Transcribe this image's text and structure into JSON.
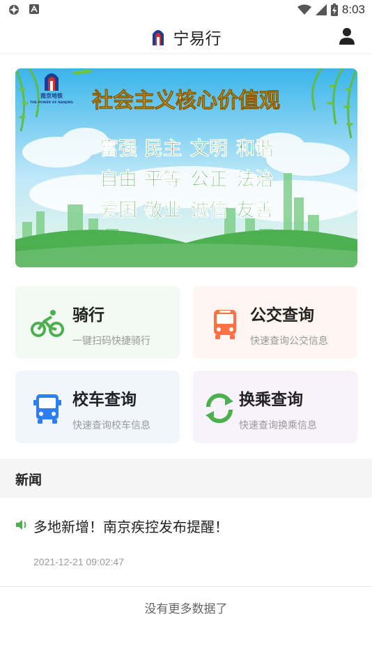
{
  "statusbar": {
    "time": "8:03",
    "icons": [
      "settings-icon",
      "notification-a-icon",
      "wifi-icon",
      "signal-icon",
      "battery-icon"
    ]
  },
  "appbar": {
    "title": "宁易行",
    "logo_icon": "nanjing-metro-logo-icon",
    "user_icon": "user-icon"
  },
  "banner": {
    "headline": "社会主义核心价值观",
    "values": [
      "富强",
      "民主",
      "文明",
      "和谐",
      "自由",
      "平等",
      "公正",
      "法治",
      "爱国",
      "敬业",
      "诚信",
      "友善"
    ],
    "logo_text": "南京地铁",
    "logo_subtext": "THE POWER OF NANJING"
  },
  "cards": [
    {
      "title": "骑行",
      "subtitle": "一键扫码快捷骑行",
      "icon": "bicycle-icon",
      "bg": "#f3f9f3",
      "color": "#4caf50"
    },
    {
      "title": "公交查询",
      "subtitle": "快速查询公交信息",
      "icon": "bus-icon",
      "bg": "#fff6f1",
      "color": "#ff7043"
    },
    {
      "title": "校车查询",
      "subtitle": "快速查询校车信息",
      "icon": "school-bus-icon",
      "bg": "#f1f6fd",
      "color": "#2e7ef0"
    },
    {
      "title": "换乘查询",
      "subtitle": "快速查询换乘信息",
      "icon": "transfer-icon",
      "bg": "#f8f3fa",
      "color": "#4caf50"
    }
  ],
  "news": {
    "section_title": "新闻",
    "items": [
      {
        "title": "多地新增！南京疾控发布提醒！",
        "time": "2021-12-21 09:02:47"
      }
    ],
    "no_more": "没有更多数据了"
  }
}
